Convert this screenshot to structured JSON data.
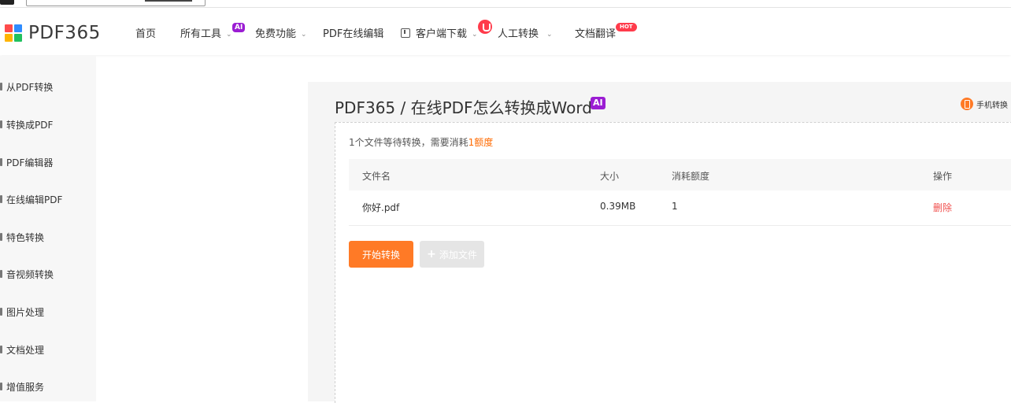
{
  "brand": {
    "logo_text": "PDF365",
    "logo_colors": [
      "#ff4b4b",
      "#2e8cff",
      "#ffb400",
      "#21c15f"
    ]
  },
  "nav": {
    "home": "首页",
    "all_tools": "所有工具",
    "all_tools_badge": "AI",
    "free_features": "免费功能",
    "online_edit": "PDF在线编辑",
    "client_download": "客户端下载",
    "manual_convert": "人工转换",
    "doc_translate": "文档翻译",
    "doc_translate_badge": "HOT"
  },
  "sidebar": {
    "items": [
      {
        "label": "从PDF转换"
      },
      {
        "label": "转换成PDF"
      },
      {
        "label": "PDF编辑器"
      },
      {
        "label": "在线编辑PDF"
      },
      {
        "label": "特色转换"
      },
      {
        "label": "音视频转换"
      },
      {
        "label": "图片处理"
      },
      {
        "label": "文档处理"
      },
      {
        "label": "增值服务"
      }
    ]
  },
  "main": {
    "title": "PDF365 / 在线PDF怎么转换成Word",
    "title_badge": "AI",
    "phone_convert": "手机转换",
    "summary_prefix": "1个文件等待转换，需要消耗",
    "summary_highlight": "1额度",
    "table": {
      "headers": {
        "name": "文件名",
        "size": "大小",
        "credit": "消耗额度",
        "op": "操作"
      },
      "rows": [
        {
          "name": "你好.pdf",
          "size": "0.39MB",
          "credit": "1",
          "op": "删除"
        }
      ]
    },
    "start_button": "开始转换",
    "add_button": "添加文件"
  },
  "colors": {
    "accent": "#ff7a26",
    "ai_badge": "#9b1dd3",
    "hot_badge": "#ff3b4b",
    "delete": "#f0504e"
  }
}
